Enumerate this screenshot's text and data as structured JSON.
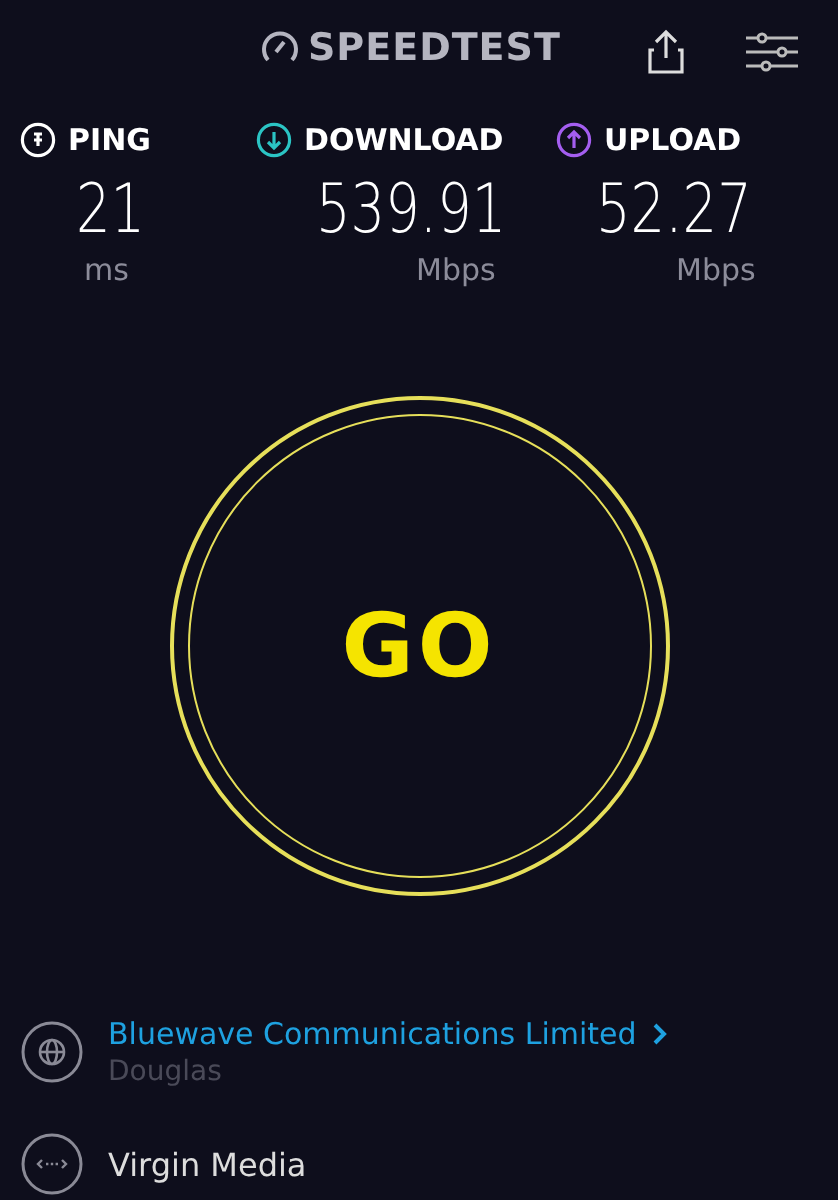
{
  "header": {
    "logo": "SPEEDTEST"
  },
  "metrics": [
    {
      "kind": "ping",
      "label": "PING",
      "value": "21",
      "unit": "ms"
    },
    {
      "kind": "download",
      "label": "DOWNLOAD",
      "value": "539.91",
      "unit": "Mbps"
    },
    {
      "kind": "upload",
      "label": "UPLOAD",
      "value": "52.27",
      "unit": "Mbps"
    }
  ],
  "go_button": {
    "label": "GO"
  },
  "connections": [
    {
      "kind": "server",
      "name": "Bluewave Communications Limited",
      "location": "Douglas"
    },
    {
      "kind": "provider",
      "name": "Virgin Media"
    }
  ]
}
